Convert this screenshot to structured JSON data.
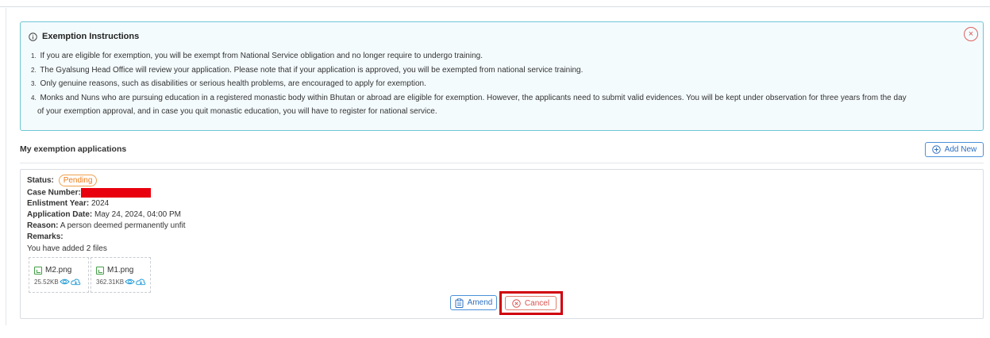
{
  "instructions": {
    "title": "Exemption Instructions",
    "close_glyph": "×",
    "items": [
      {
        "num": "1.",
        "text": "If you are eligible for exemption, you will be exempt from National Service obligation and no longer require to undergo training."
      },
      {
        "num": "2.",
        "text": "The Gyalsung Head Office will review your application. Please note that if your application is approved, you will be exempted from national service training."
      },
      {
        "num": "3.",
        "text": "Only genuine reasons, such as disabilities or serious health problems, are encouraged to apply for exemption."
      },
      {
        "num": "4.",
        "text": "Monks and Nuns who are pursuing education in a registered monastic body within Bhutan or abroad are eligible for exemption. However, the applicants need to submit valid evidences. You will be kept under observation for three years from the day",
        "continuation": "of your exemption approval, and in case you quit monastic education, you will have to register for national service."
      }
    ]
  },
  "section": {
    "title": "My exemption applications",
    "add_new_label": "Add New"
  },
  "application": {
    "status_label": "Status:",
    "status_value": "Pending",
    "case_number_label": "Case Number:",
    "enlistment_year_label": "Enlistment Year:",
    "enlistment_year_value": "2024",
    "application_date_label": "Application Date:",
    "application_date_value": "May 24, 2024, 04:00 PM",
    "reason_label": "Reason:",
    "reason_value": "A person deemed permanently unfit",
    "remarks_label": "Remarks:",
    "files_text": "You have added 2 files",
    "files": [
      {
        "name": "M2.png",
        "size": "25.52KB"
      },
      {
        "name": "M1.png",
        "size": "362.31KB"
      }
    ]
  },
  "actions": {
    "amend_label": "Amend",
    "cancel_label": "Cancel"
  },
  "colors": {
    "accent": "#2e6fc0",
    "info_border": "#6ec6d6",
    "pending": "#ef7c1a",
    "cancel": "#d9534f",
    "highlight": "#d0000c"
  }
}
